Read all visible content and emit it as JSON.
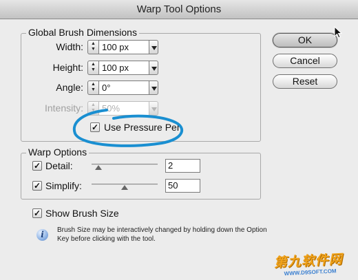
{
  "window": {
    "title": "Warp Tool Options"
  },
  "global_brush": {
    "group_label": "Global Brush Dimensions",
    "width": {
      "label": "Width:",
      "value": "100 px"
    },
    "height": {
      "label": "Height:",
      "value": "100 px"
    },
    "angle": {
      "label": "Angle:",
      "value": "0°"
    },
    "intensity": {
      "label": "Intensity:",
      "value": "50%",
      "disabled": true
    },
    "use_pressure_pen": {
      "label": "Use Pressure Pen",
      "checked": true
    }
  },
  "warp_options": {
    "group_label": "Warp Options",
    "detail": {
      "label": "Detail:",
      "checked": true,
      "value": "2",
      "slider_fraction": 0.1
    },
    "simplify": {
      "label": "Simplify:",
      "checked": true,
      "value": "50",
      "slider_fraction": 0.5
    }
  },
  "show_brush_size": {
    "label": "Show Brush Size",
    "checked": true
  },
  "info": {
    "icon": "info-icon",
    "text": "Brush Size may be interactively changed by holding down the Option Key before clicking with the tool."
  },
  "buttons": {
    "ok": "OK",
    "cancel": "Cancel",
    "reset": "Reset"
  },
  "annotation": {
    "circle_color": "#1a8fd1"
  },
  "watermark": {
    "main": "第九软件网",
    "sub": "WWW.D9SOFT.COM"
  }
}
